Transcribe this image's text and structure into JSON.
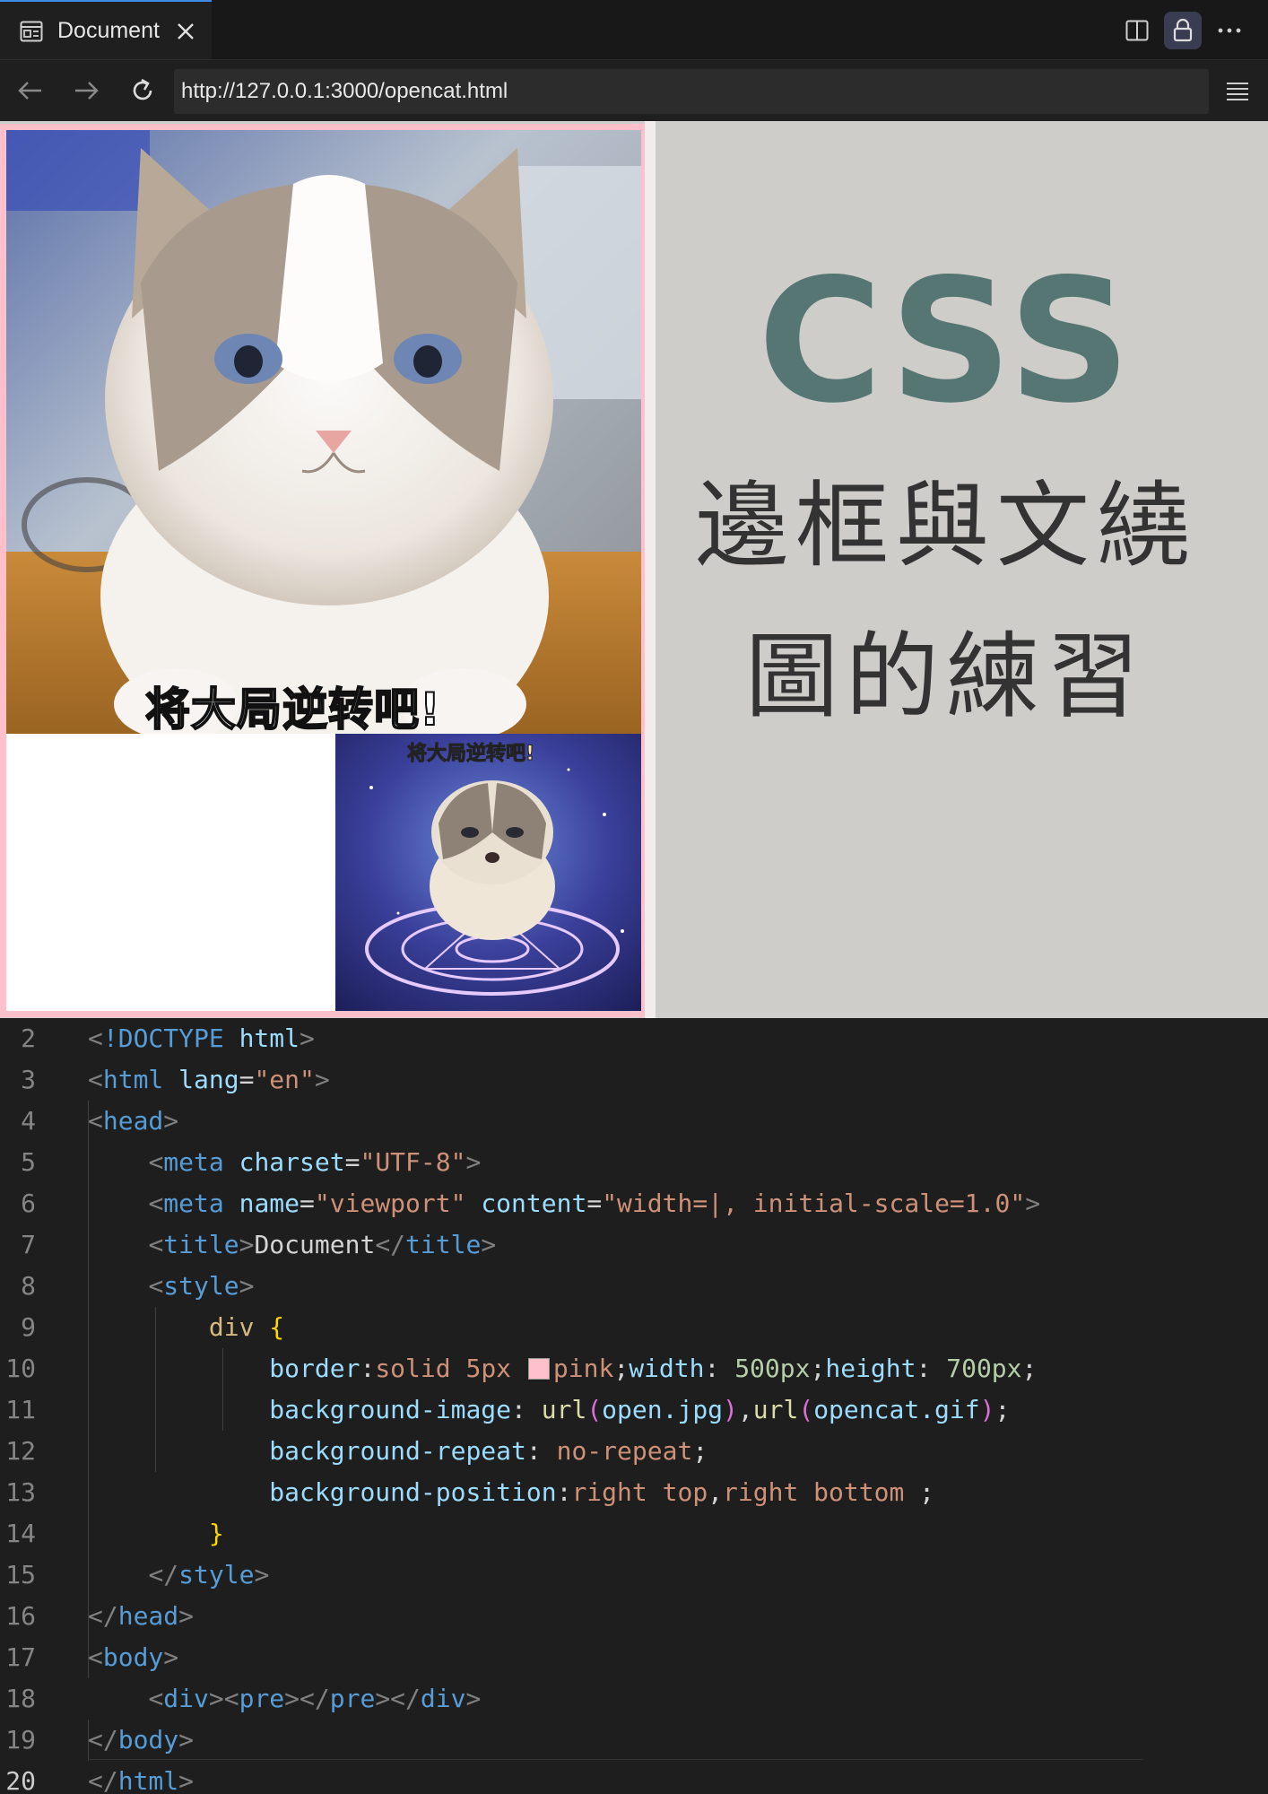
{
  "tab": {
    "title": "Document"
  },
  "address_bar": {
    "url": "http://127.0.0.1:3000/opencat.html"
  },
  "page": {
    "demo_div": {
      "photo_caption": "将大局逆转吧!",
      "gif_caption": "将大局逆转吧!"
    },
    "heading": "CSS",
    "subtitle_line1": "邊框與文繞",
    "subtitle_line2": "圖的練習"
  },
  "editor": {
    "active_line": "20",
    "lines": [
      {
        "n": "2"
      },
      {
        "n": "3"
      },
      {
        "n": "4"
      },
      {
        "n": "5"
      },
      {
        "n": "6"
      },
      {
        "n": "7"
      },
      {
        "n": "8"
      },
      {
        "n": "9"
      },
      {
        "n": "10"
      },
      {
        "n": "11"
      },
      {
        "n": "12"
      },
      {
        "n": "13"
      },
      {
        "n": "14"
      },
      {
        "n": "15"
      },
      {
        "n": "16"
      },
      {
        "n": "17"
      },
      {
        "n": "18"
      },
      {
        "n": "19"
      },
      {
        "n": "20"
      }
    ],
    "code": {
      "l2_doctype": "!DOCTYPE",
      "l2_html": "html",
      "l3_tag": "html",
      "l3_attr": "lang",
      "l3_val": "\"en\"",
      "l4_tag": "head",
      "l5_tag": "meta",
      "l5_attr": "charset",
      "l5_val": "\"UTF-8\"",
      "l6_tag": "meta",
      "l6_attr1": "name",
      "l6_val1": "\"viewport\"",
      "l6_attr2": "content",
      "l6_val2": "\"width=|, initial-scale=1.0\"",
      "l7_tag": "title",
      "l7_text": "Document",
      "l8_tag": "style",
      "l9_sel": "div",
      "l9_brace": "{",
      "l10_p1": "border",
      "l10_v1": "solid 5px",
      "l10_v1b": "pink",
      "l10_p2": "width",
      "l10_n2": "500px",
      "l10_p3": "height",
      "l10_n3": "700px",
      "l11_p": "background-image",
      "l11_f1": "url",
      "l11_a1": "open.jpg",
      "l11_f2": "url",
      "l11_a2": "opencat.gif",
      "l12_p": "background-repeat",
      "l12_v": "no-repeat",
      "l13_p": "background-position",
      "l13_v1": "right top",
      "l13_v2": "right bottom",
      "l14_brace": "}",
      "l15_tag": "style",
      "l16_tag": "head",
      "l17_tag": "body",
      "l18_tag1": "div",
      "l18_tag2": "pre",
      "l18_tag3": "pre",
      "l18_tag4": "div",
      "l19_tag": "body",
      "l20_tag": "html"
    }
  },
  "colors": {
    "border_pink": "#ffc0cb",
    "heading_teal": "#557672",
    "page_bg": "#cfcdca",
    "editor_bg": "#1e1e1e"
  },
  "icons": [
    "document-icon",
    "close-icon",
    "split-editor-icon",
    "lock-icon",
    "more-icon",
    "back-arrow-icon",
    "forward-arrow-icon",
    "reload-icon",
    "menu-icon"
  ]
}
